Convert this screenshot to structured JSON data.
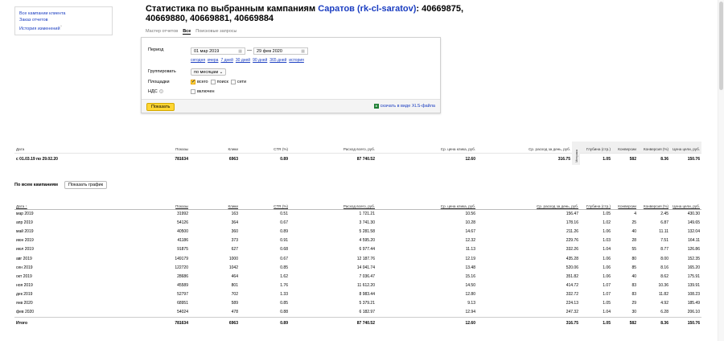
{
  "nav": {
    "links": [
      "Все кампании клиента",
      "Заказ отчетов",
      "История изменений"
    ],
    "history_badge": "?"
  },
  "header": {
    "title_prefix": "Статистика по выбранным кампаниям",
    "campaign_link": "Саратов (rk-cl-saratov)",
    "title_ids": ": 40669875, 40669880, 40669881, 40669884"
  },
  "tabs": [
    "Мастер отчетов",
    "Все",
    "Поисковые запросы"
  ],
  "filters": {
    "period_label": "Период",
    "date_from": "01 мар 2019",
    "date_to": "29 фев 2020",
    "dash": "—",
    "quick_ranges": [
      "сегодня",
      "вчера",
      "7 дней",
      "30 дней",
      "90 дней",
      "365 дней",
      "история"
    ],
    "group_label": "Группировать",
    "group_value": "по месяцам",
    "places_label": "Площадки",
    "places_options": [
      {
        "label": "всего",
        "checked": true
      },
      {
        "label": "поиск",
        "checked": false
      },
      {
        "label": "сети",
        "checked": false
      }
    ],
    "vat_label": "НДС",
    "vat_option": "включен",
    "show_button": "Показать",
    "xls_link": "скачать в виде XLS-файла"
  },
  "summary": {
    "headers": [
      "Дата",
      "Показы",
      "Клики",
      "CTR (%)",
      "Расход всего, руб.",
      "Ср. цена клика, руб.",
      "Ср. расход за день, руб."
    ],
    "extra_headers": [
      "Глубина (стр.)",
      "Конверсии",
      "Конверсия (%)",
      "Цена цели, руб."
    ],
    "vertical_tab": "Метрика",
    "row": [
      "с 01.03.19 по 29.02.20",
      "781634",
      "6963",
      "0.89",
      "87 740.52",
      "12.60",
      "316.75",
      "1.05",
      "582",
      "8.36",
      "150.76"
    ]
  },
  "section": {
    "title": "По всем кампаниям",
    "chart_button": "Показать график"
  },
  "table": {
    "headers": [
      "Дата ↑",
      "Показы",
      "Клики",
      "CTR (%)",
      "Расход всего, руб.",
      "Ср. цена клика, руб.",
      "Ср. расход за день, руб.",
      "Глубина (стр.)",
      "Конверсии",
      "Конверсия (%)",
      "Цена цели, руб."
    ],
    "rows": [
      [
        "мар 2019",
        "31992",
        "163",
        "0.51",
        "1 721.21",
        "10.56",
        "156.47",
        "1.05",
        "4",
        "2.45",
        "430.30"
      ],
      [
        "апр 2019",
        "54126",
        "364",
        "0.67",
        "3 741.30",
        "10.28",
        "178.16",
        "1.02",
        "25",
        "6.87",
        "149.65"
      ],
      [
        "май 2019",
        "40500",
        "360",
        "0.89",
        "5 281.58",
        "14.67",
        "211.26",
        "1.06",
        "40",
        "11.11",
        "132.04"
      ],
      [
        "июн 2019",
        "41186",
        "373",
        "0.91",
        "4 595.20",
        "12.32",
        "229.76",
        "1.03",
        "28",
        "7.51",
        "164.11"
      ],
      [
        "июл 2019",
        "91875",
        "627",
        "0.68",
        "6 977.44",
        "11.13",
        "332.26",
        "1.04",
        "55",
        "8.77",
        "126.86"
      ],
      [
        "авг 2019",
        "149179",
        "1000",
        "0.67",
        "12 187.76",
        "12.19",
        "435.28",
        "1.06",
        "80",
        "8.00",
        "152.35"
      ],
      [
        "сен 2019",
        "122720",
        "1042",
        "0.85",
        "14 041.74",
        "13.48",
        "520.06",
        "1.06",
        "85",
        "8.16",
        "165.20"
      ],
      [
        "окт 2019",
        "28686",
        "464",
        "1.62",
        "7 036.47",
        "15.16",
        "351.82",
        "1.06",
        "40",
        "8.62",
        "175.91"
      ],
      [
        "ноя 2019",
        "45589",
        "801",
        "1.76",
        "11 612.20",
        "14.50",
        "414.72",
        "1.07",
        "83",
        "10.36",
        "139.91"
      ],
      [
        "дек 2019",
        "52797",
        "702",
        "1.33",
        "8 983.44",
        "12.80",
        "332.72",
        "1.07",
        "83",
        "11.82",
        "108.23"
      ],
      [
        "янв 2020",
        "68951",
        "589",
        "0.85",
        "5 379.21",
        "9.13",
        "224.13",
        "1.05",
        "29",
        "4.92",
        "185.49"
      ],
      [
        "фев 2020",
        "54024",
        "478",
        "0.88",
        "6 182.97",
        "12.94",
        "247.32",
        "1.04",
        "30",
        "6.28",
        "206.10"
      ]
    ],
    "total": [
      "Итого",
      "781634",
      "6963",
      "0.89",
      "87 740.52",
      "12.60",
      "316.75",
      "1.05",
      "582",
      "8.36",
      "150.76"
    ]
  }
}
